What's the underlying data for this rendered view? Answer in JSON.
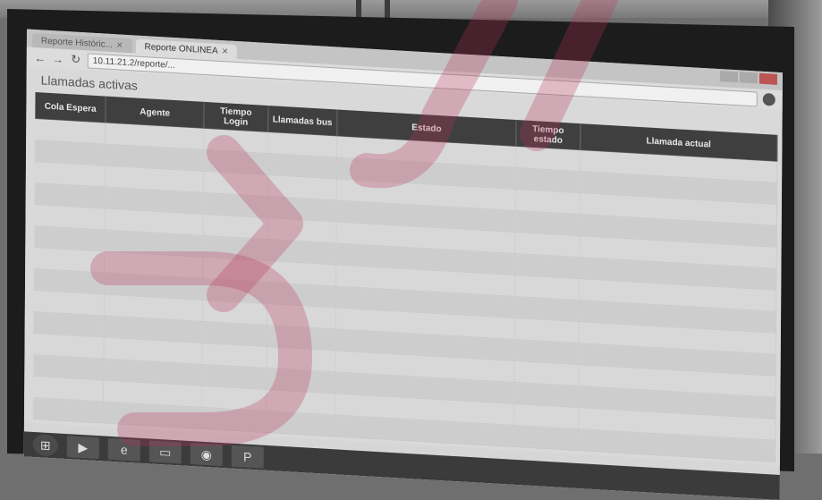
{
  "browser": {
    "tabs": [
      {
        "label": "Reporte Históric...",
        "active": false
      },
      {
        "label": "Reporte ONLINEA",
        "active": true
      }
    ],
    "address": "10.11.21.2/reporte/..."
  },
  "page": {
    "title": "Llamadas activas"
  },
  "table": {
    "headers": [
      "Cola Espera",
      "Agente",
      "Tiempo Login",
      "Llamadas bus",
      "Estado",
      "Tiempo estado",
      "Llamada actual"
    ],
    "rows": [
      [
        "",
        "",
        "",
        "",
        "",
        "",
        ""
      ],
      [
        "",
        "",
        "",
        "",
        "",
        "",
        ""
      ],
      [
        "",
        "",
        "",
        "",
        "",
        "",
        ""
      ],
      [
        "",
        "",
        "",
        "",
        "",
        "",
        ""
      ],
      [
        "",
        "",
        "",
        "",
        "",
        "",
        ""
      ],
      [
        "",
        "",
        "",
        "",
        "",
        "",
        ""
      ],
      [
        "",
        "",
        "",
        "",
        "",
        "",
        ""
      ],
      [
        "",
        "",
        "",
        "",
        "",
        "",
        ""
      ],
      [
        "",
        "",
        "",
        "",
        "",
        "",
        ""
      ],
      [
        "",
        "",
        "",
        "",
        "",
        "",
        ""
      ],
      [
        "",
        "",
        "",
        "",
        "",
        "",
        ""
      ],
      [
        "",
        "",
        "",
        "",
        "",
        "",
        ""
      ],
      [
        "",
        "",
        "",
        "",
        "",
        "",
        ""
      ],
      [
        "",
        "",
        "",
        "",
        "",
        "",
        ""
      ]
    ]
  },
  "taskbar": {
    "items": [
      "windows-start",
      "media-player",
      "internet-explorer",
      "file-explorer",
      "chrome",
      "powerpoint"
    ]
  }
}
